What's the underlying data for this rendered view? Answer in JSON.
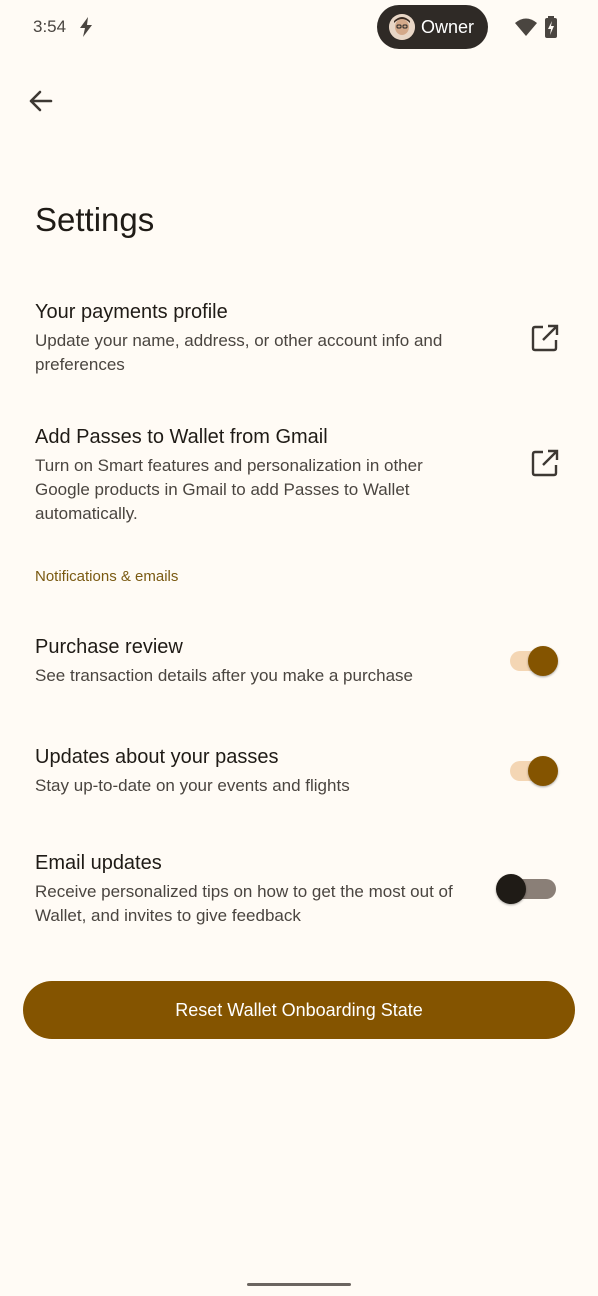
{
  "status_bar": {
    "time": "3:54",
    "owner_label": "Owner",
    "icons": [
      "flash-icon",
      "wifi-icon",
      "battery-charging-icon"
    ]
  },
  "header": {
    "back_icon": "arrow-back-icon",
    "title": "Settings"
  },
  "links": [
    {
      "title": "Your payments profile",
      "description": "Update your name, address, or other account info and preferences",
      "icon": "open-in-new-icon"
    },
    {
      "title": "Add Passes to Wallet from Gmail",
      "description": "Turn on Smart features and personalization in other Google products in Gmail to add Passes to Wallet automatically.",
      "icon": "open-in-new-icon"
    }
  ],
  "notifications": {
    "section_label": "Notifications & emails",
    "items": [
      {
        "title": "Purchase review",
        "description": "See transaction details after you make a purchase",
        "enabled": true
      },
      {
        "title": "Updates about your passes",
        "description": "Stay up-to-date on your events and flights",
        "enabled": true
      },
      {
        "title": "Email updates",
        "description": "Receive personalized tips on how to get the most out of Wallet, and invites to give feedback",
        "enabled": false
      }
    ]
  },
  "reset_button": {
    "label": "Reset Wallet Onboarding State"
  },
  "colors": {
    "background": "#fffbf5",
    "accent": "#845400",
    "toggle_track_on": "#f4d6b4",
    "section_header": "#7a5a12",
    "owner_pill": "#2f2a26"
  }
}
